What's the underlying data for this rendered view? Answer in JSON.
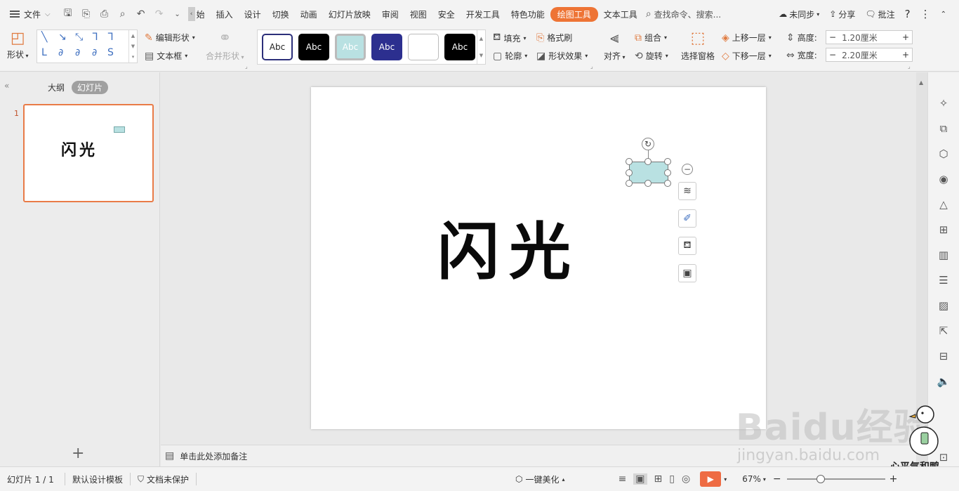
{
  "menubar": {
    "file": "文件",
    "tabs": [
      "始",
      "插入",
      "设计",
      "切换",
      "动画",
      "幻灯片放映",
      "审阅",
      "视图",
      "安全",
      "开发工具",
      "特色功能",
      "绘图工具",
      "文本工具"
    ],
    "active_tab": "绘图工具",
    "search": "查找命令、搜索...",
    "sync": "未同步",
    "share": "分享",
    "comment": "批注",
    "help": "?"
  },
  "ribbon": {
    "shape_label": "形状",
    "edit_shape": "编辑形状",
    "text_box": "文本框",
    "merge_shape": "合并形状",
    "style_samples": [
      "Abc",
      "Abc",
      "Abc",
      "Abc",
      "",
      "Abc"
    ],
    "fill": "填充",
    "format_painter": "格式刷",
    "outline": "轮廓",
    "shape_effect": "形状效果",
    "align": "对齐",
    "group": "组合",
    "rotate": "旋转",
    "select_pane": "选择窗格",
    "bring_forward": "上移一层",
    "send_backward": "下移一层",
    "height_label": "高度:",
    "height_value": "1.20厘米",
    "width_label": "宽度:",
    "width_value": "2.20厘米"
  },
  "leftpane": {
    "tab_outline": "大纲",
    "tab_slides": "幻灯片",
    "slide_number": "1",
    "thumb_title": "闪光",
    "add": "+"
  },
  "slide": {
    "title": "闪光"
  },
  "notes": {
    "placeholder": "单击此处添加备注"
  },
  "statusbar": {
    "slide_info": "幻灯片 1 / 1",
    "template": "默认设计模板",
    "protect": "文档未保护",
    "beautify": "一键美化",
    "zoom": "67%"
  },
  "watermark": {
    "brand": "Baidu经验",
    "url": "jingyan.baidu.com",
    "signature": "心平气和鸭"
  },
  "colors": {
    "accent": "#ee7435",
    "shape_fill": "#b9e1e2",
    "play": "#ee6b43",
    "thumb_border": "#e97b47"
  }
}
